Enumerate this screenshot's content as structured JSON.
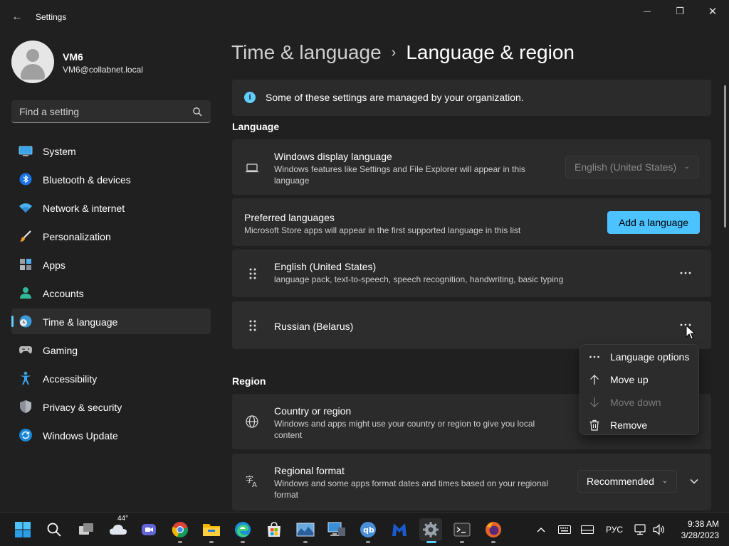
{
  "window": {
    "title": "Settings",
    "back_glyph": "←",
    "minimize_glyph": "—",
    "maximize_glyph": "❐",
    "close_glyph": "✕"
  },
  "user": {
    "name": "VM6",
    "email": "VM6@collabnet.local"
  },
  "search": {
    "placeholder": "Find a setting"
  },
  "sidebar": {
    "items": [
      {
        "label": "System",
        "icon": "system-icon"
      },
      {
        "label": "Bluetooth & devices",
        "icon": "bluetooth-icon"
      },
      {
        "label": "Network & internet",
        "icon": "wifi-icon"
      },
      {
        "label": "Personalization",
        "icon": "brush-icon"
      },
      {
        "label": "Apps",
        "icon": "apps-icon"
      },
      {
        "label": "Accounts",
        "icon": "accounts-icon"
      },
      {
        "label": "Time & language",
        "icon": "time-language-icon",
        "active": true
      },
      {
        "label": "Gaming",
        "icon": "gamepad-icon"
      },
      {
        "label": "Accessibility",
        "icon": "accessibility-icon"
      },
      {
        "label": "Privacy & security",
        "icon": "shield-icon"
      },
      {
        "label": "Windows Update",
        "icon": "update-icon"
      }
    ]
  },
  "breadcrumb": {
    "parent": "Time & language",
    "separator": "›",
    "current": "Language & region"
  },
  "info_bar": {
    "text": "Some of these settings are managed by your organization.",
    "icon_glyph": "i"
  },
  "language_section": {
    "heading": "Language",
    "display_language": {
      "title": "Windows display language",
      "subtitle_line1": "Windows features like Settings and File Explorer will appear in this",
      "subtitle_line2": "language",
      "value": "English (United States)"
    },
    "preferred": {
      "title": "Preferred languages",
      "subtitle": "Microsoft Store apps will appear in the first supported language in this list",
      "button": "Add a language"
    },
    "languages": [
      {
        "name": "English (United States)",
        "features": "language pack, text-to-speech, speech recognition, handwriting, basic typing"
      },
      {
        "name": "Russian (Belarus)",
        "features": ""
      }
    ],
    "more_glyph": "···"
  },
  "context_menu": {
    "items": [
      {
        "label": "Language options",
        "icon": "more-icon",
        "disabled": false
      },
      {
        "label": "Move up",
        "icon": "arrow-up-icon",
        "disabled": false
      },
      {
        "label": "Move down",
        "icon": "arrow-down-icon",
        "disabled": true
      },
      {
        "label": "Remove",
        "icon": "trash-icon",
        "disabled": false
      }
    ]
  },
  "region_section": {
    "heading": "Region",
    "country": {
      "title": "Country or region",
      "subtitle_line1": "Windows and apps might use your country or region to give you local",
      "subtitle_line2": "content"
    },
    "format": {
      "title": "Regional format",
      "subtitle_line1": "Windows and some apps format dates and times based on your regional",
      "subtitle_line2": "format",
      "value": "Recommended"
    }
  },
  "taskbar": {
    "weather_temp": "44°",
    "input_lang": "РУС",
    "time": "9:38 AM",
    "date": "3/28/2023",
    "tray_chevron": "^",
    "apps": [
      "start-icon",
      "search-icon",
      "task-view-icon",
      "weather-icon",
      "teams-icon",
      "chrome-icon",
      "file-explorer-icon",
      "edge-icon",
      "store-icon",
      "photo-app-icon",
      "remote-desktop-icon",
      "qbittorrent-icon",
      "malwarebytes-icon",
      "settings-icon",
      "terminal-icon",
      "firefox-icon"
    ]
  },
  "colors": {
    "background": "#202020",
    "card": "#2b2b2b",
    "accent": "#60cdff",
    "accent_button": "#4cc2ff"
  }
}
